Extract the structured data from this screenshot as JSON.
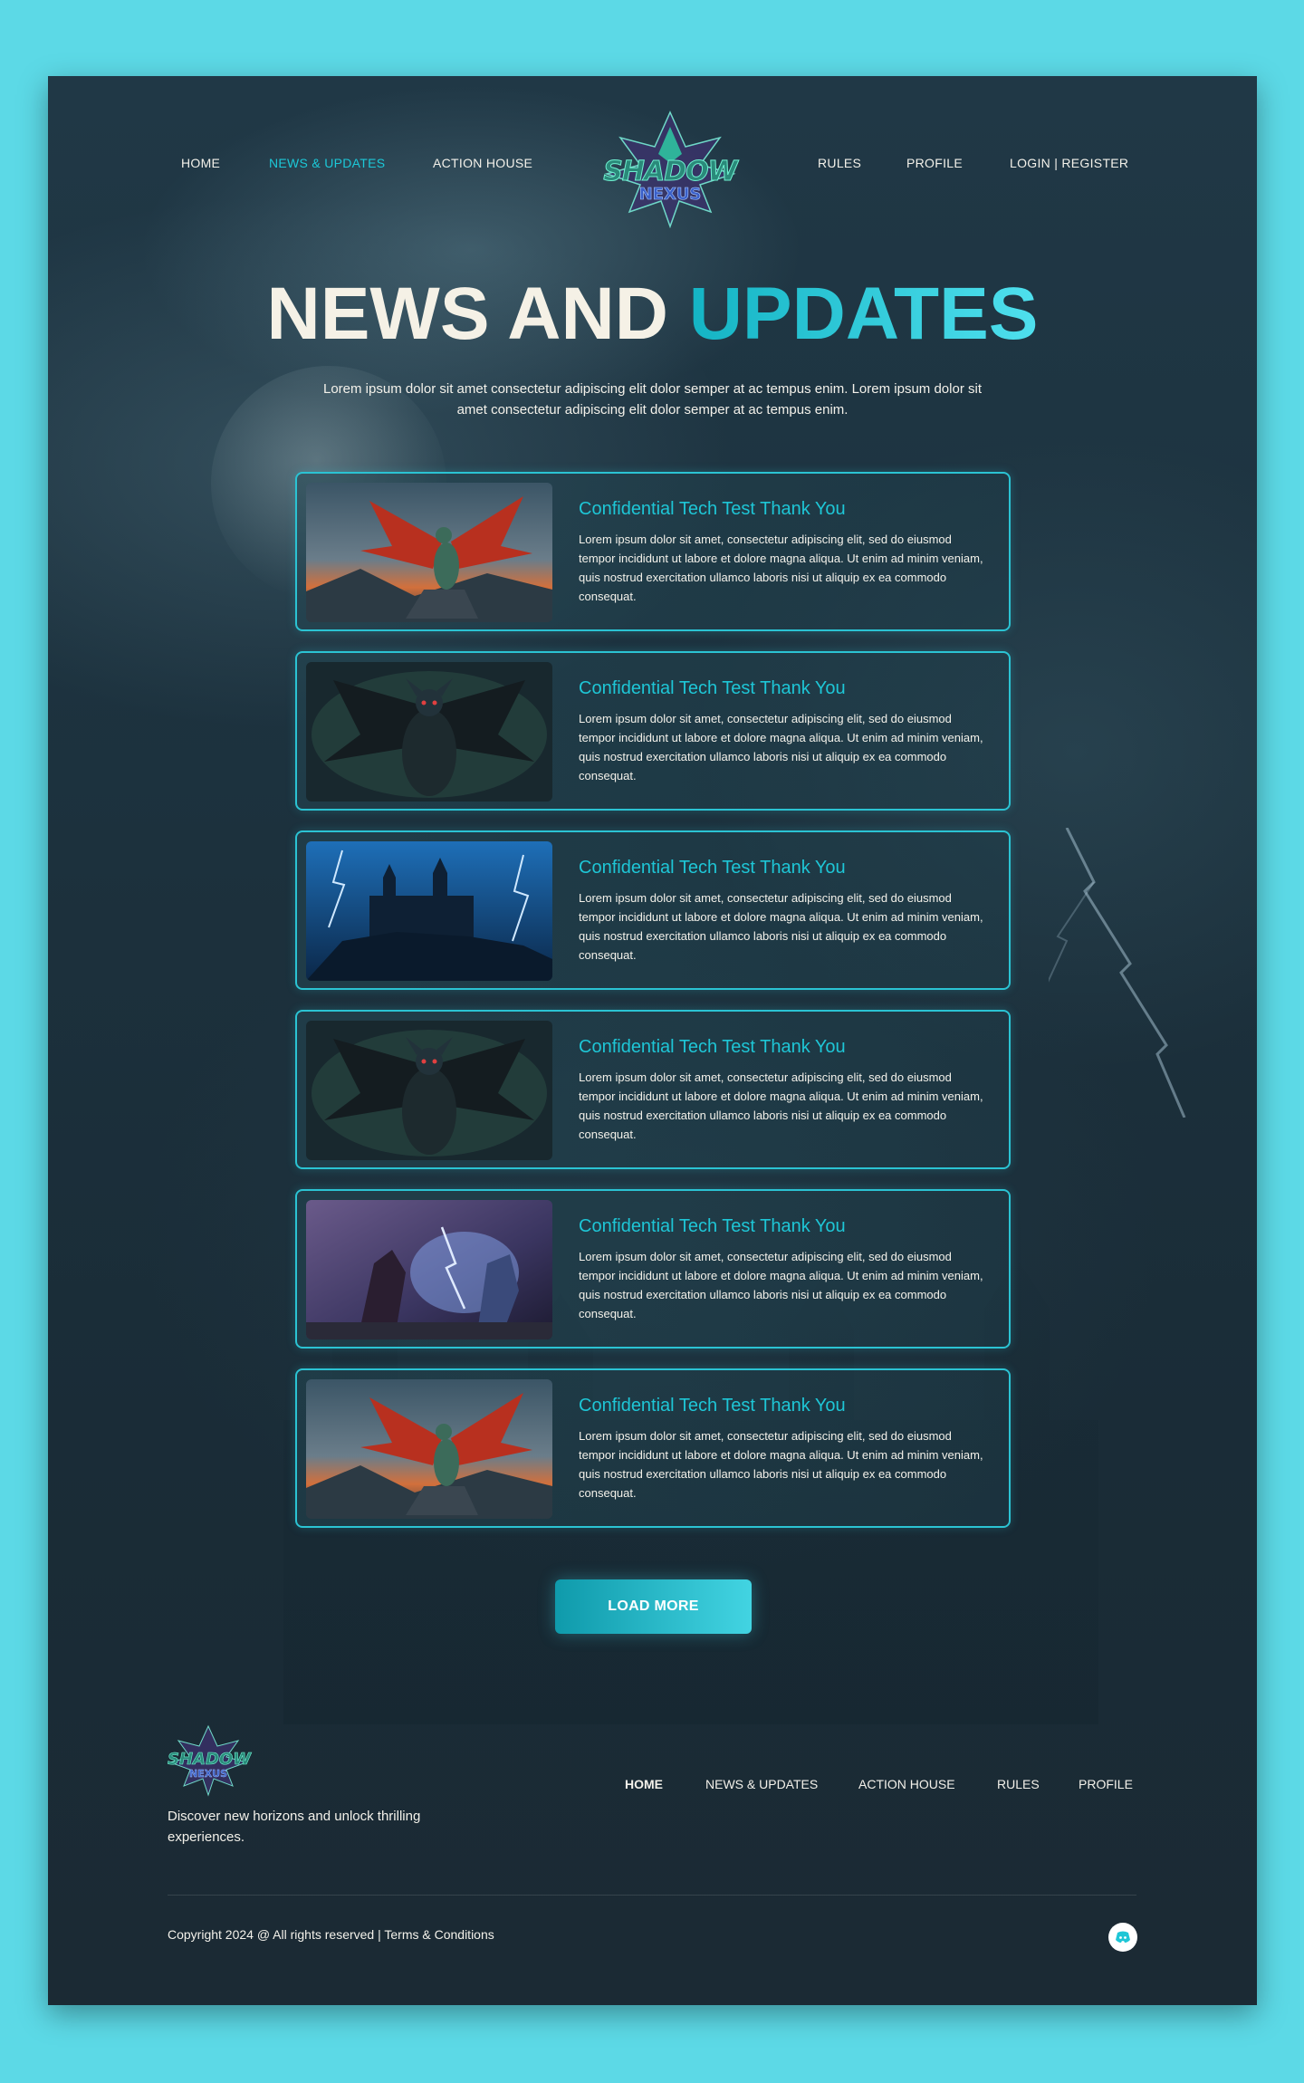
{
  "nav": {
    "left": [
      "HOME",
      "NEWS & UPDATES",
      "ACTION HOUSE"
    ],
    "right": [
      "RULES",
      "PROFILE",
      "LOGIN | REGISTER"
    ],
    "active_index": 1
  },
  "logo": {
    "line1": "SHADOW",
    "line2": "NEXUS"
  },
  "hero": {
    "title_part1": "NEWS AND",
    "title_part2": "UPDATES",
    "subtitle": "Lorem ipsum dolor sit amet consectetur adipiscing elit dolor semper at ac tempus enim. Lorem ipsum dolor sit amet consectetur adipiscing elit dolor semper at ac tempus enim."
  },
  "cards": [
    {
      "title": "Confidential Tech Test Thank You",
      "text": "Lorem ipsum dolor sit amet, consectetur adipiscing elit, sed do eiusmod tempor incididunt ut labore et dolore magna aliqua. Ut enim ad minim veniam, quis nostrud exercitation ullamco laboris nisi ut aliquip ex ea commodo consequat.",
      "image": "dragon"
    },
    {
      "title": "Confidential Tech Test Thank You",
      "text": "Lorem ipsum dolor sit amet, consectetur adipiscing elit, sed do eiusmod tempor incididunt ut labore et dolore magna aliqua. Ut enim ad minim veniam, quis nostrud exercitation ullamco laboris nisi ut aliquip ex ea commodo consequat.",
      "image": "demon"
    },
    {
      "title": "Confidential Tech Test Thank You",
      "text": "Lorem ipsum dolor sit amet, consectetur adipiscing elit, sed do eiusmod tempor incididunt ut labore et dolore magna aliqua. Ut enim ad minim veniam, quis nostrud exercitation ullamco laboris nisi ut aliquip ex ea commodo consequat.",
      "image": "castle"
    },
    {
      "title": "Confidential Tech Test Thank You",
      "text": "Lorem ipsum dolor sit amet, consectetur adipiscing elit, sed do eiusmod tempor incididunt ut labore et dolore magna aliqua. Ut enim ad minim veniam, quis nostrud exercitation ullamco laboris nisi ut aliquip ex ea commodo consequat.",
      "image": "demon"
    },
    {
      "title": "Confidential Tech Test Thank You",
      "text": "Lorem ipsum dolor sit amet, consectetur adipiscing elit, sed do eiusmod tempor incididunt ut labore et dolore magna aliqua. Ut enim ad minim veniam, quis nostrud exercitation ullamco laboris nisi ut aliquip ex ea commodo consequat.",
      "image": "battle"
    },
    {
      "title": "Confidential Tech Test Thank You",
      "text": "Lorem ipsum dolor sit amet, consectetur adipiscing elit, sed do eiusmod tempor incididunt ut labore et dolore magna aliqua. Ut enim ad minim veniam, quis nostrud exercitation ullamco laboris nisi ut aliquip ex ea commodo consequat.",
      "image": "dragon"
    }
  ],
  "load_more": "LOAD MORE",
  "footer": {
    "logo_line1": "SHADOW",
    "logo_line2": "NEXUS",
    "tagline": "Discover new horizons and unlock thrilling experiences.",
    "nav": [
      "HOME",
      "NEWS & UPDATES",
      "ACTION HOUSE",
      "RULES",
      "PROFILE"
    ],
    "active_index": 0,
    "copyright": "Copyright 2024 @ All rights reserved | Terms & Conditions",
    "social_icon": "discord-icon"
  },
  "colors": {
    "accent": "#1ec6d6",
    "page_bg": "#5cd9e6",
    "panel_bg": "#1c313d",
    "text": "#f3f1ea"
  }
}
